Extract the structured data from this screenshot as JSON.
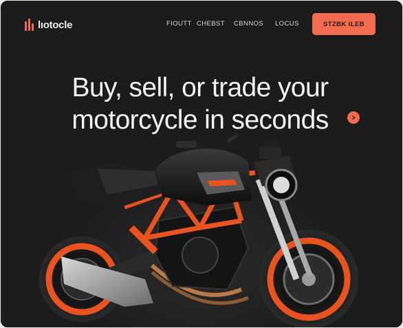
{
  "brand": {
    "name": "lıotocle"
  },
  "nav": {
    "items": [
      {
        "label": "FIOUTT"
      },
      {
        "label": "CHEBST"
      },
      {
        "label": "CBNNOS"
      },
      {
        "label": "LOCUS"
      }
    ]
  },
  "cta": {
    "label": "STZBK ILEB"
  },
  "hero": {
    "headline_line1": "Buy, sell, or trade your",
    "headline_line2": "motorcycle in seconds"
  },
  "colors": {
    "accent": "#f26b4f",
    "background": "#1b1b1c",
    "text": "#f4f4f4"
  },
  "icons": {
    "logo": "bars-logo-icon",
    "hero_dot": "arrow-right-icon"
  }
}
